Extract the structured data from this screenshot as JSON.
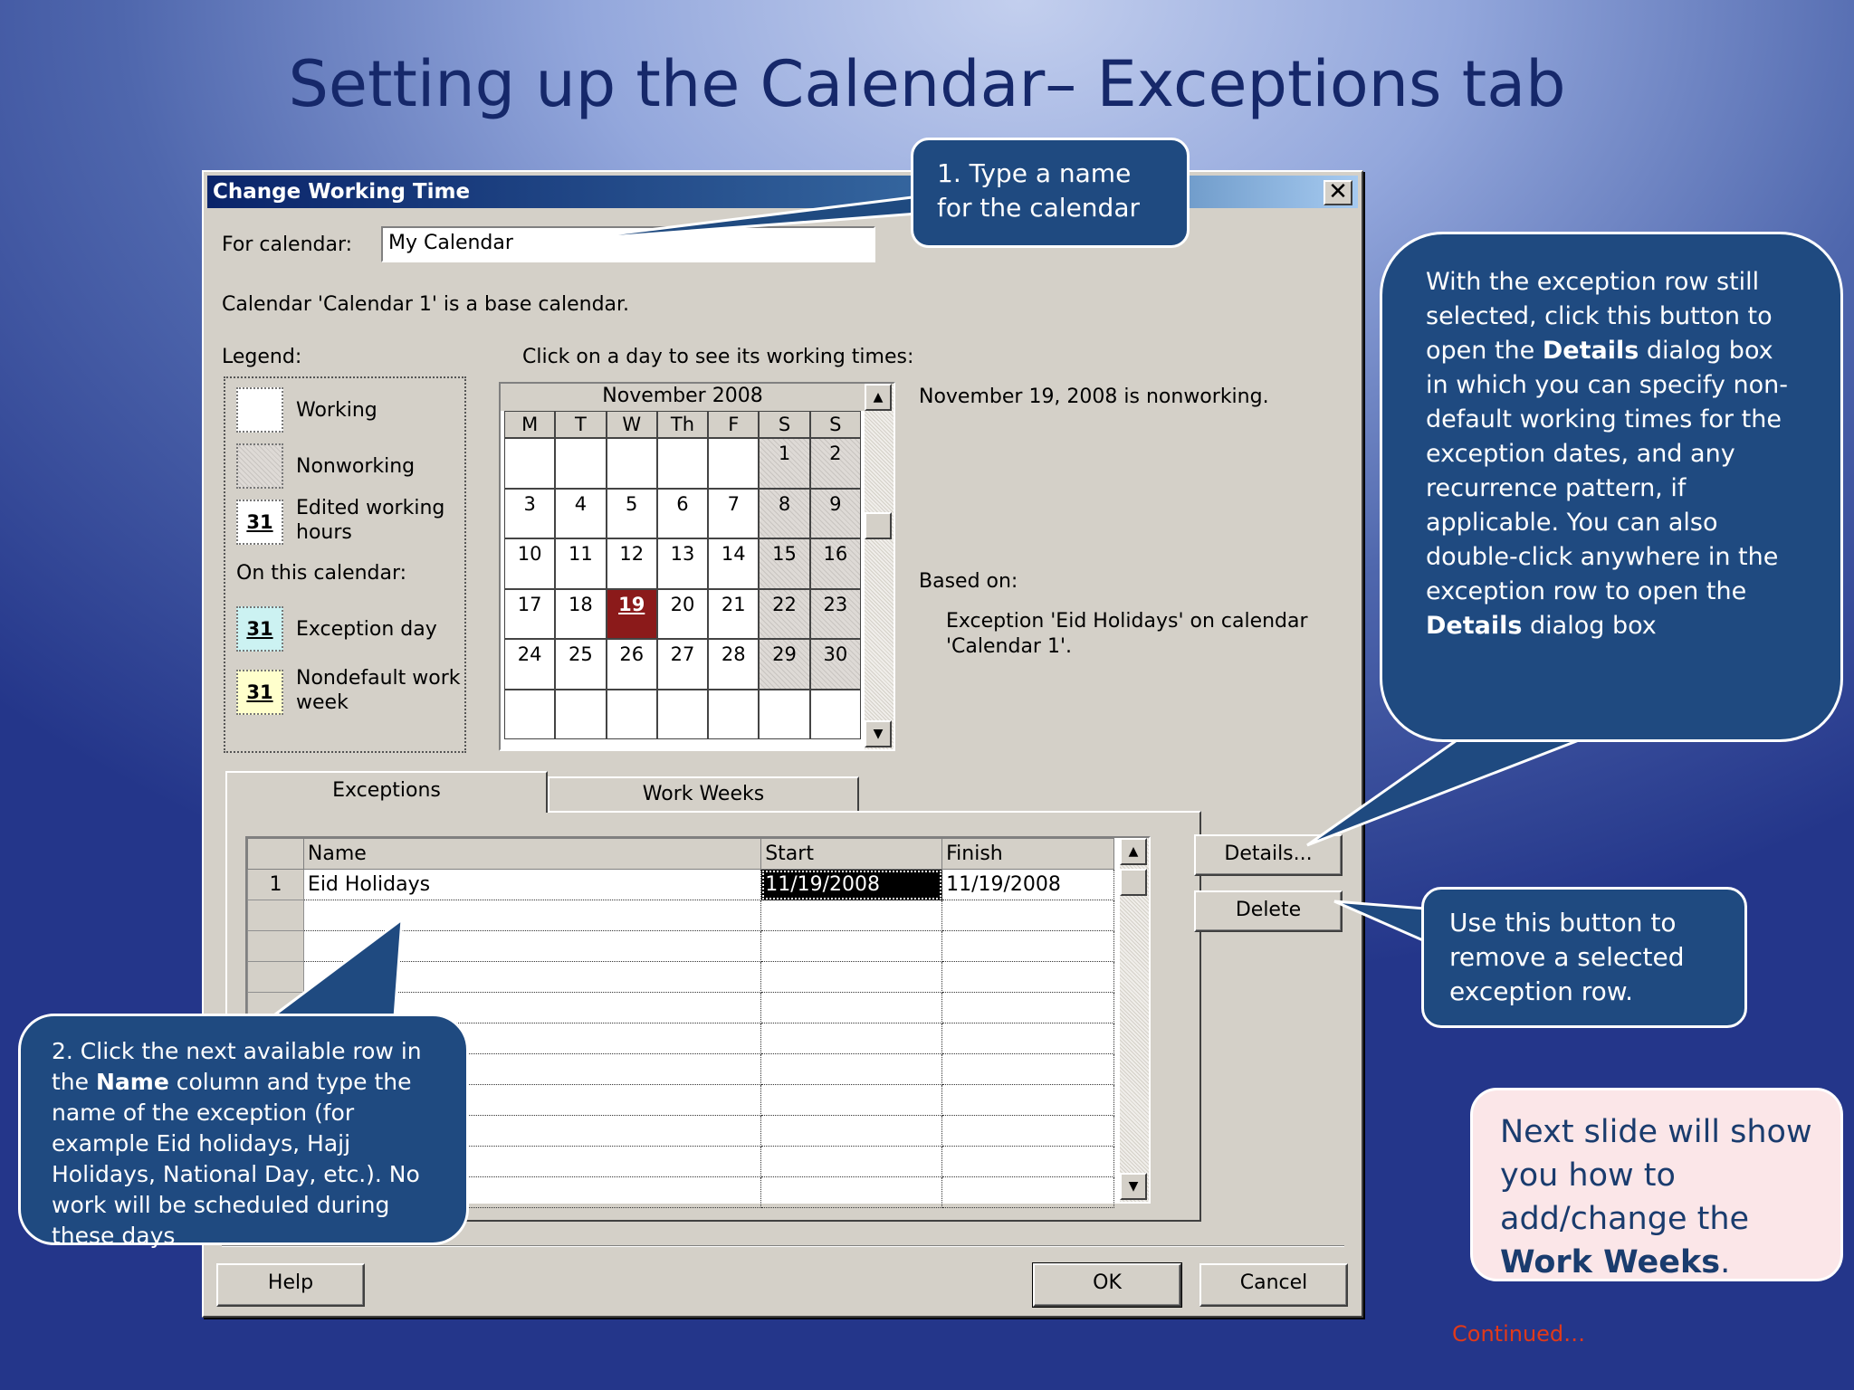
{
  "slide": {
    "title": "Setting up the Calendar– Exceptions tab",
    "continued": "Continued…",
    "next_slide_note": {
      "pre": "Next slide will show you how to add/change the ",
      "bold": "Work Weeks",
      "post": "."
    }
  },
  "dialog": {
    "title": "Change Working Time",
    "close_glyph": "✕",
    "for_calendar_label": "For calendar:",
    "for_calendar_value": "My Calendar",
    "base_calendar_text": "Calendar 'Calendar 1' is a base calendar.",
    "legend_label": "Legend:",
    "legend": {
      "working": "Working",
      "nonworking": "Nonworking",
      "edited_line1": "Edited working",
      "edited_line2": "hours",
      "on_this_calendar": "On this calendar:",
      "exception_day": "Exception day",
      "nondefault_line1": "Nondefault work",
      "nondefault_line2": "week",
      "swatch_number": "31"
    },
    "calendar_prompt": "Click on a day to see its working times:",
    "calendar": {
      "month": "November 2008",
      "weekdays": [
        "M",
        "T",
        "W",
        "Th",
        "F",
        "S",
        "S"
      ],
      "weeks": [
        [
          "",
          "",
          "",
          "",
          "",
          "1",
          "2"
        ],
        [
          "3",
          "4",
          "5",
          "6",
          "7",
          "8",
          "9"
        ],
        [
          "10",
          "11",
          "12",
          "13",
          "14",
          "15",
          "16"
        ],
        [
          "17",
          "18",
          "19",
          "20",
          "21",
          "22",
          "23"
        ],
        [
          "24",
          "25",
          "26",
          "27",
          "28",
          "29",
          "30"
        ],
        [
          "",
          "",
          "",
          "",
          "",
          "",
          ""
        ]
      ],
      "selected_day": "19"
    },
    "day_status": "November 19, 2008 is nonworking.",
    "based_on_label": "Based on:",
    "based_on_line1": "Exception 'Eid Holidays' on calendar",
    "based_on_line2": "'Calendar 1'.",
    "tabs": [
      "Exceptions",
      "Work Weeks"
    ],
    "table": {
      "columns": [
        "Name",
        "Start",
        "Finish"
      ],
      "rows": [
        {
          "num": "1",
          "name": "Eid Holidays",
          "start": "11/19/2008",
          "finish": "11/19/2008"
        }
      ],
      "empty_rows": 10
    },
    "buttons": {
      "details": "Details...",
      "delete": "Delete",
      "help": "Help",
      "ok": "OK",
      "cancel": "Cancel"
    }
  },
  "callouts": {
    "name": "1. Type a name for the calendar",
    "details": {
      "p1": "With the exception row still selected, click this button to open the ",
      "b1": "Details",
      "p2": " dialog box in which you can specify non-default working times for the exception dates, and any recurrence pattern, if applicable. You can also double-click anywhere in the exception row to open the ",
      "b2": "Details",
      "p3": " dialog box"
    },
    "delete": "Use this button to remove a selected exception row.",
    "row": {
      "p1": "2. Click the next available row in the ",
      "b1": "Name",
      "p2": " column and type the name of the exception (for example Eid holidays, Hajj Holidays, National Day, etc.). No work will be scheduled during these days"
    }
  },
  "colors": {
    "callout_fill": "#1f4a80",
    "title_text": "#16286a",
    "selected_day": "#8b1a1a",
    "continued": "#e03a1a"
  }
}
